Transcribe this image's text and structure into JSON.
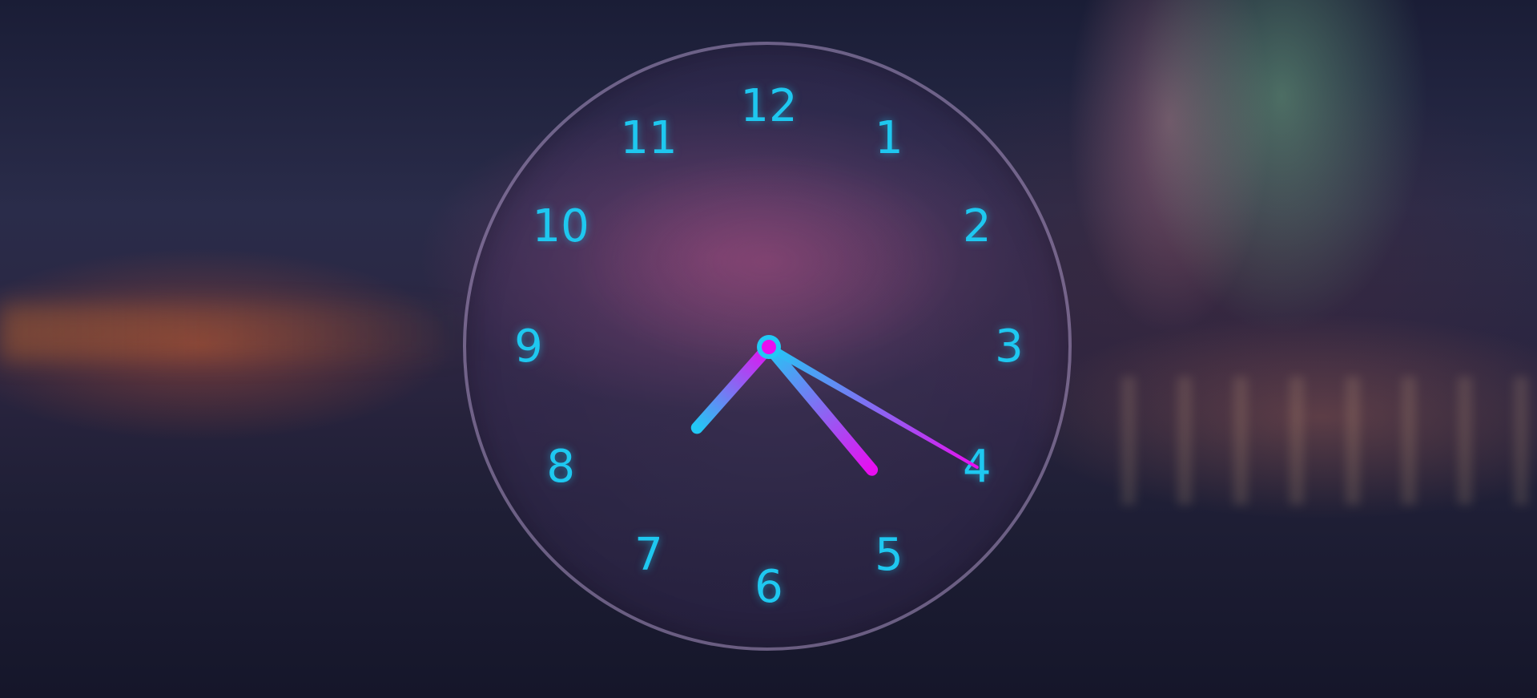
{
  "clock": {
    "numerals": [
      "12",
      "1",
      "2",
      "3",
      "4",
      "5",
      "6",
      "7",
      "8",
      "9",
      "10",
      "11"
    ],
    "time": {
      "hours": 7,
      "minutes": 23,
      "seconds": 20
    },
    "colors": {
      "numeral": "#1ec8f0",
      "hand_gradient_start": "#22c8f5",
      "hand_gradient_end": "#e80ef0",
      "center_ring": "#22c8f5",
      "center_dot": "#e80ef0",
      "face_border": "#b9a7d6"
    }
  },
  "wallpaper": {
    "description_icon": "aurora-landscape"
  }
}
